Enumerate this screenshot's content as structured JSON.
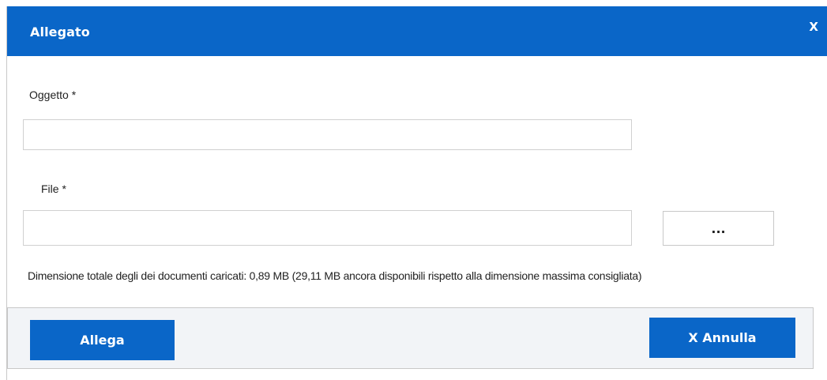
{
  "dialog": {
    "title": "Allegato",
    "close_label": "X"
  },
  "form": {
    "subject_label": "Oggetto *",
    "subject_value": "",
    "subject_placeholder": "",
    "file_label": "File *",
    "file_value": "",
    "file_placeholder": "",
    "browse_label": "..."
  },
  "info": {
    "size_text": "Dimensione totale degli dei documenti caricati: 0,89 MB (29,11 MB ancora disponibili rispetto alla dimensione massima consigliata)"
  },
  "footer": {
    "attach_label": "Allega",
    "cancel_label": "X Annulla"
  },
  "colors": {
    "accent": "#0a66c8",
    "footer_bg": "#f2f4f7"
  }
}
